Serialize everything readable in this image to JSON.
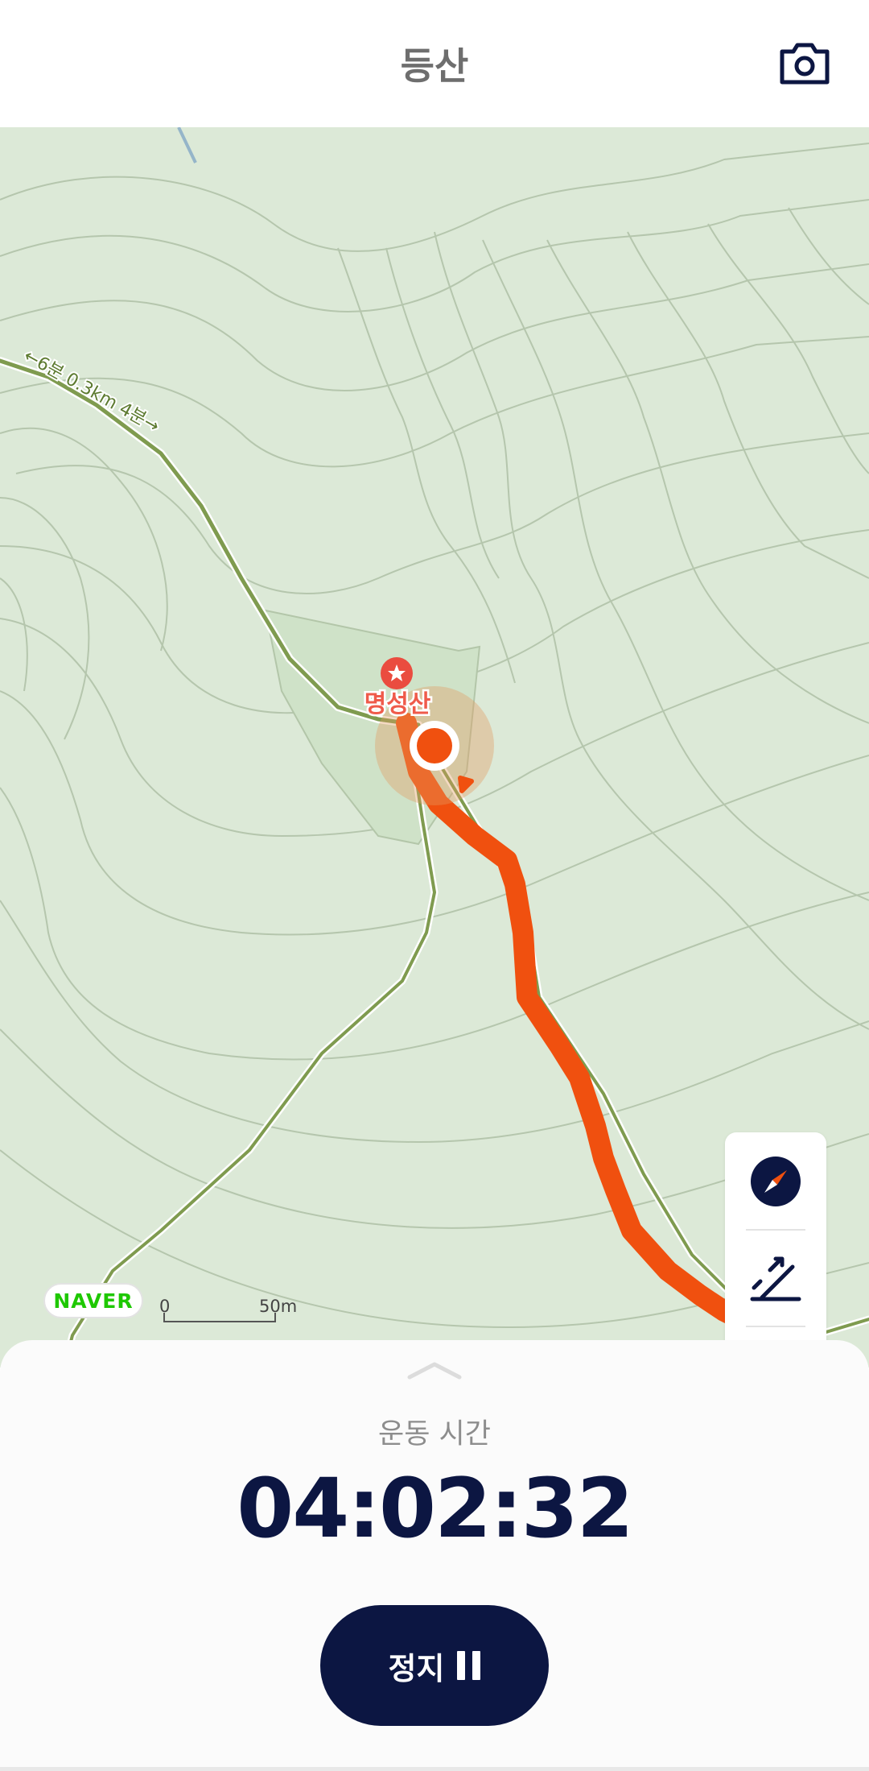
{
  "header": {
    "title": "등산",
    "camera_icon": "camera-icon"
  },
  "map": {
    "trail_label": "←6분 0.3km 4분→",
    "peak_name": "명성산",
    "logo_text": "NAVER",
    "scale": {
      "min_label": "0",
      "max_label": "50m"
    },
    "colors": {
      "route": "#f0500f",
      "trail": "#7f9b4f",
      "land": "#dce9d7",
      "contour": "#b5c6ad"
    },
    "controls": [
      "compass-icon",
      "elevation-icon",
      "locate-icon"
    ]
  },
  "sheet": {
    "label": "운동 시간",
    "time": "04:02:32",
    "stop_button": {
      "label": "정지",
      "icon": "pause-icon"
    }
  }
}
